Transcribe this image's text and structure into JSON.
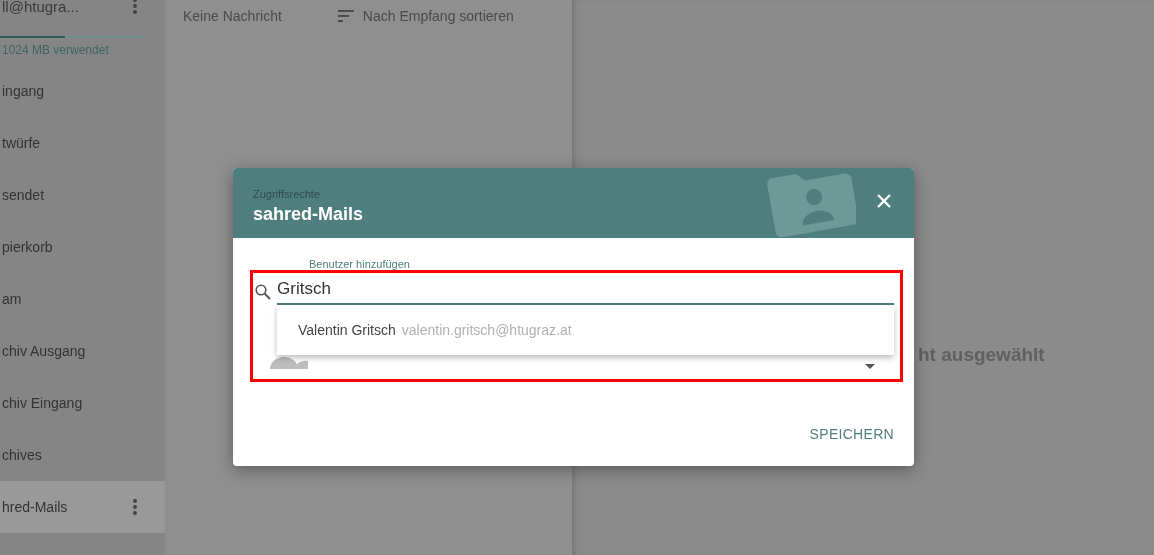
{
  "sidebar": {
    "account": "ll@htugra...",
    "quota": {
      "text": "1024 MB verwendet",
      "level": 0.45
    },
    "folders": [
      {
        "label": "ingang",
        "selected": false
      },
      {
        "label": "twürfe",
        "selected": false
      },
      {
        "label": "sendet",
        "selected": false
      },
      {
        "label": "pierkorb",
        "selected": false
      },
      {
        "label": "am",
        "selected": false
      },
      {
        "label": "chiv Ausgang",
        "selected": false
      },
      {
        "label": "chiv Eingang",
        "selected": false
      },
      {
        "label": "chives",
        "selected": false
      },
      {
        "label": "hred-Mails",
        "selected": true
      }
    ]
  },
  "message_list": {
    "status": "Keine Nachricht",
    "sort": "Nach Empfang sortieren"
  },
  "reading_pane": {
    "empty_text": "ht ausgewählt"
  },
  "dialog": {
    "subtitle": "Zugriffsrechte",
    "title": "sahred-Mails",
    "field": {
      "label": "Benutzer hinzufügen",
      "value": "Gritsch"
    },
    "suggestions": [
      {
        "name": "Valentin Gritsch",
        "email": "valentin.gritsch@htugraz.at"
      }
    ],
    "buttons": [
      "SPEICHERN"
    ]
  }
}
